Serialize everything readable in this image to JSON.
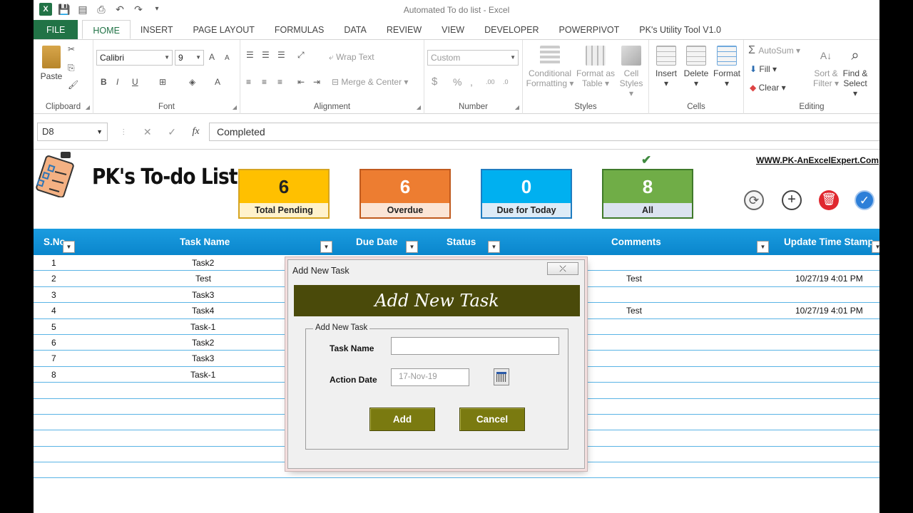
{
  "window": {
    "title": "Automated To do list - Excel"
  },
  "tabs": [
    "FILE",
    "HOME",
    "INSERT",
    "PAGE LAYOUT",
    "FORMULAS",
    "DATA",
    "REVIEW",
    "VIEW",
    "DEVELOPER",
    "POWERPIVOT",
    "PK's Utility Tool V1.0"
  ],
  "ribbon": {
    "clipboard": {
      "label": "Clipboard",
      "paste": "Paste"
    },
    "font": {
      "label": "Font",
      "name": "Calibri",
      "size": "9",
      "bold": "B",
      "italic": "I",
      "underline": "U",
      "grow": "A",
      "shrink": "A",
      "color": "A"
    },
    "alignment": {
      "label": "Alignment",
      "wrap": "Wrap Text",
      "merge": "Merge & Center"
    },
    "number": {
      "label": "Number",
      "format": "Custom",
      "currency": "$",
      "percent": "%",
      "comma": ",",
      "inc_dec": ".00",
      "dec_dec": ".0"
    },
    "styles": {
      "label": "Styles",
      "conditional_1": "Conditional",
      "conditional_2": "Formatting",
      "format_table_1": "Format as",
      "format_table_2": "Table",
      "cell_styles_1": "Cell",
      "cell_styles_2": "Styles"
    },
    "cells": {
      "label": "Cells",
      "insert": "Insert",
      "delete": "Delete",
      "format": "Format"
    },
    "editing": {
      "label": "Editing",
      "autosum": "AutoSum",
      "fill": "Fill",
      "clear": "Clear",
      "sort_1": "Sort &",
      "sort_2": "Filter",
      "find_1": "Find &",
      "find_2": "Select"
    }
  },
  "formula_bar": {
    "cell_ref": "D8",
    "cancel": "✕",
    "enter": "✓",
    "fx": "fx",
    "value": "Completed"
  },
  "sheet": {
    "title": "PK's To-do List",
    "website": "WWW.PK-AnExcelExpert.Com",
    "kpis": [
      {
        "value": "6",
        "label": "Total Pending"
      },
      {
        "value": "6",
        "label": "Overdue"
      },
      {
        "value": "0",
        "label": "Due for Today"
      },
      {
        "value": "8",
        "label": "All"
      }
    ],
    "selected_marker": "✔",
    "actions": {
      "refresh": "⟳",
      "add": "+",
      "delete": "🗑",
      "complete": "✓"
    }
  },
  "table": {
    "headers": {
      "sno": "S.No",
      "task": "Task Name",
      "due": "Due Date",
      "status": "Status",
      "comments": "Comments",
      "updated": "Update Time Stamp"
    },
    "rows": [
      {
        "sno": "1",
        "task": "Task2",
        "comment": "",
        "stamp": ""
      },
      {
        "sno": "2",
        "task": "Test",
        "comment": "Test",
        "stamp": "10/27/19 4:01 PM"
      },
      {
        "sno": "3",
        "task": "Task3",
        "comment": "",
        "stamp": ""
      },
      {
        "sno": "4",
        "task": "Task4",
        "comment": "Test",
        "stamp": "10/27/19 4:01 PM"
      },
      {
        "sno": "5",
        "task": "Task-1",
        "comment": "",
        "stamp": ""
      },
      {
        "sno": "6",
        "task": "Task2",
        "comment": "",
        "stamp": ""
      },
      {
        "sno": "7",
        "task": "Task3",
        "comment": "",
        "stamp": ""
      },
      {
        "sno": "8",
        "task": "Task-1",
        "comment": "",
        "stamp": ""
      }
    ],
    "empty_rows": 6
  },
  "dialog": {
    "title": "Add New Task",
    "close": "⤫",
    "banner": "Add New Task",
    "frame_label": "Add New Task",
    "task_name_label": "Task Name",
    "task_name_value": "",
    "action_date_label": "Action Date",
    "action_date_value": "17-Nov-19",
    "add_button": "Add",
    "cancel_button": "Cancel"
  },
  "colors": {
    "excel_green": "#217346",
    "header_blue": "#0a86cc",
    "dialog_olive": "#4a4a0a",
    "button_olive": "#7a7a10"
  }
}
